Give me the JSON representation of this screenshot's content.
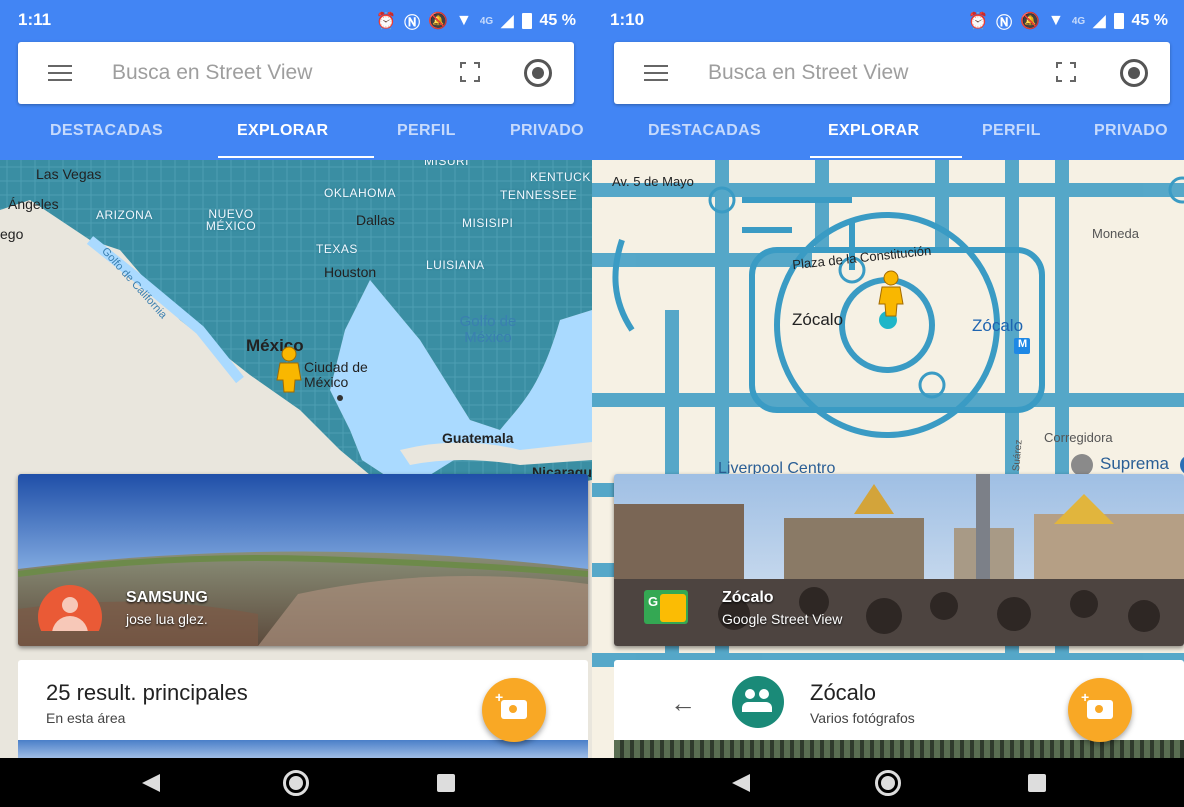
{
  "colors": {
    "brand": "#4285f4",
    "tab_inactive": "#c6dafc",
    "fab": "#f9a825",
    "map_coverage": "#3a8ea3",
    "avatar": "#ea5a36",
    "group_avatar": "#1a8a78"
  },
  "left": {
    "status": {
      "time": "1:11",
      "battery": "45 %",
      "network": "4G"
    },
    "search": {
      "placeholder": "Busca en Street View"
    },
    "tabs": [
      "DESTACADAS",
      "EXPLORAR",
      "PERFIL",
      "PRIVADO"
    ],
    "active_tab": "EXPLORAR",
    "map_labels": {
      "las_vegas": "Las Vegas",
      "angeles": "Ángeles",
      "ego": "ego",
      "arizona": "ARIZONA",
      "nuevo_mexico": "NUEVO MÉXICO",
      "oklahoma": "OKLAHOMA",
      "tennessee": "TENNESSEE",
      "kentucky": "KENTUCK",
      "misuri": "MISURI",
      "dallas": "Dallas",
      "misisipi": "MISISIPI",
      "texas": "TEXAS",
      "houston": "Houston",
      "luisiana": "LUISIANA",
      "golfo_california": "Golfo de California",
      "golfo_mexico": "Golfo de México",
      "mexico": "México",
      "ciudad_mexico": "Ciudad de México",
      "guatemala": "Guatemala",
      "nicaragua": "Nicaragu"
    },
    "photo_card": {
      "title": "SAMSUNG",
      "subtitle": "jose lua glez."
    },
    "results_card": {
      "title": "25 result. principales",
      "subtitle": "En esta área"
    },
    "fab_icon": "add-photo-icon"
  },
  "right": {
    "status": {
      "time": "1:10",
      "battery": "45 %",
      "network": "4G"
    },
    "search": {
      "placeholder": "Busca en Street View"
    },
    "tabs": [
      "DESTACADAS",
      "EXPLORAR",
      "PERFIL",
      "PRIVADO"
    ],
    "active_tab": "EXPLORAR",
    "map_labels": {
      "av_mayo": "Av. 5 de Mayo",
      "plaza": "Plaza de la Constitución",
      "zocalo_main": "Zócalo",
      "zocalo_metro": "Zócalo",
      "metro": "M",
      "moneda": "Moneda",
      "corregidora": "Corregidora",
      "liverpool": "Liverpool Centro",
      "suprema": "Suprema",
      "suarez": "Suárez"
    },
    "photo_card": {
      "title": "Zócalo",
      "subtitle": "Google Street View"
    },
    "place_card": {
      "title": "Zócalo",
      "subtitle": "Varios fotógrafos"
    },
    "fab_icon": "add-photo-icon"
  }
}
